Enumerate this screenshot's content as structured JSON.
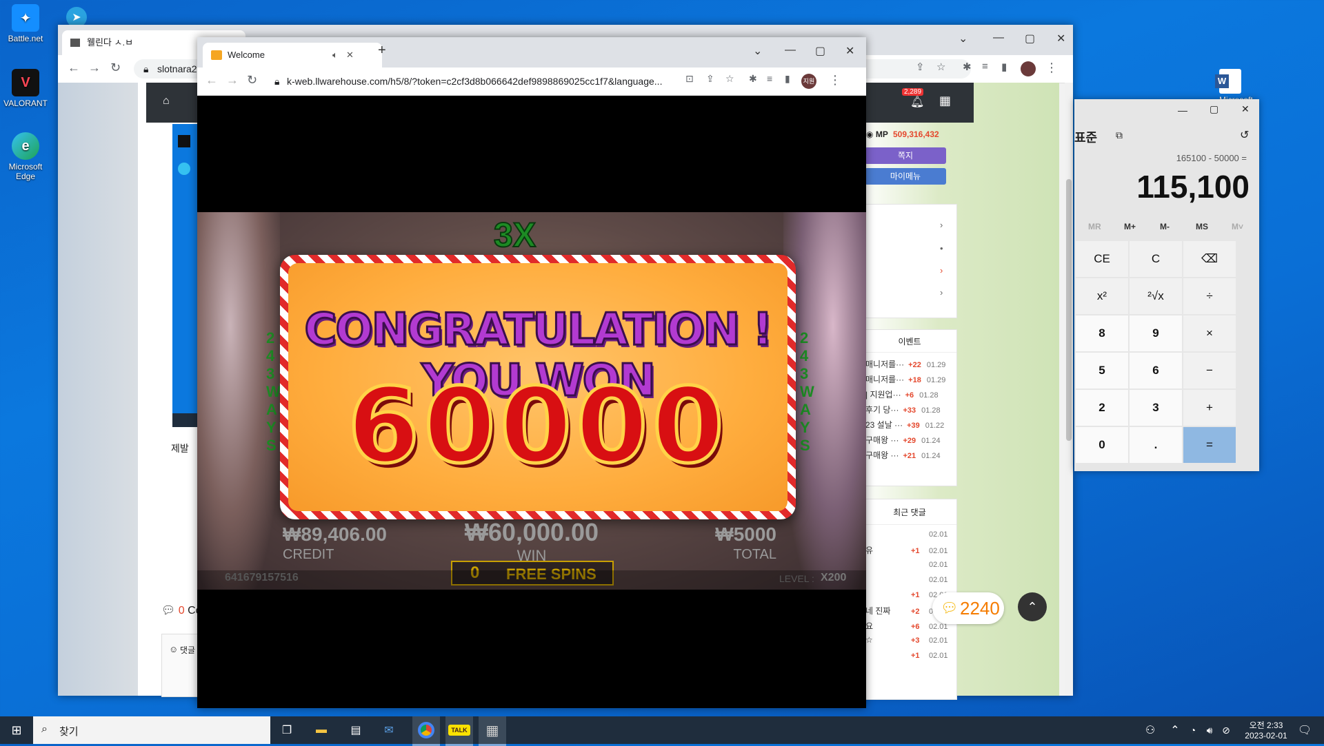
{
  "desktop": {
    "icons": [
      {
        "label": "Battle.net"
      },
      {
        "label": "VALORANT"
      },
      {
        "label": "Microsoft Edge"
      }
    ],
    "word_label": "Microsoft"
  },
  "back_browser": {
    "tab_title": "웰린다 ㅅ.ㅂ",
    "url": "slotnara2.",
    "notif_count": "2,289",
    "mp_label": "MP",
    "mp_value": "509,316,432",
    "btn_message": "쪽지",
    "btn_mymenu": "마이메뉴",
    "event_header": "이벤트",
    "events": [
      {
        "title": "매니저를···",
        "plus": "+22",
        "date": "01.29"
      },
      {
        "title": "매니저를···",
        "plus": "+18",
        "date": "01.29"
      },
      {
        "title": "| 지원업···",
        "plus": "+6",
        "date": "01.28"
      },
      {
        "title": "후기 당···",
        "plus": "+33",
        "date": "01.28"
      },
      {
        "title": "23 설날 ···",
        "plus": "+39",
        "date": "01.22"
      },
      {
        "title": "구매왕 ···",
        "plus": "+29",
        "date": "01.24"
      },
      {
        "title": "구매왕 ···",
        "plus": "+21",
        "date": "01.24"
      }
    ],
    "recent_header": "최근 댓글",
    "recent": [
      {
        "title": "",
        "plus": "",
        "date": "02.01"
      },
      {
        "title": "유",
        "plus": "+1",
        "date": "02.01"
      },
      {
        "title": "",
        "plus": "",
        "date": "02.01"
      },
      {
        "title": "",
        "plus": "",
        "date": "02.01"
      },
      {
        "title": "",
        "plus": "+1",
        "date": "02.01"
      },
      {
        "title": "네 진짜",
        "plus": "+2",
        "date": "02.01"
      },
      {
        "title": "요",
        "plus": "+6",
        "date": "02.01"
      },
      {
        "title": "☆",
        "plus": "+3",
        "date": "02.01"
      },
      {
        "title": "",
        "plus": "+1",
        "date": "02.01"
      }
    ],
    "left_text": "제발",
    "comment_count": "0",
    "comment_label": "Co",
    "comment_box": "댓글",
    "chat_count": "2240"
  },
  "front_browser": {
    "tab_title": "Welcome",
    "url": "k-web.llwarehouse.com/h5/8/?token=c2cf3d8b066642def9898869025cc1f7&language...",
    "profile": "지원"
  },
  "game": {
    "multiplier": "3X",
    "side_text": "243 WAYS",
    "congrats": "CONGRATULATION ! YOU WON",
    "big_win": "60000",
    "credit_value": "₩89,406.00",
    "credit_label": "CREDIT",
    "win_value": "₩60,000.00",
    "win_label": "WIN",
    "total_value": "₩5000",
    "total_label": "TOTAL",
    "free_spins_count": "0",
    "free_spins_label": "FREE SPINS",
    "round_id": "641679157516",
    "level_label": "LEVEL :",
    "level_value": "X200"
  },
  "calculator": {
    "mode": "표준",
    "expression": "165100 - 50000 =",
    "result": "115,100",
    "memory": [
      "MR",
      "M+",
      "M-",
      "MS",
      "M˅"
    ],
    "keys": [
      [
        "CE",
        "C",
        "⌫"
      ],
      [
        "x²",
        "²√x",
        "÷"
      ],
      [
        "8",
        "9",
        "×"
      ],
      [
        "5",
        "6",
        "−"
      ],
      [
        "2",
        "3",
        "+"
      ],
      [
        "0",
        ".",
        "="
      ]
    ]
  },
  "taskbar": {
    "search_placeholder": "찾기",
    "time": "오전 2:33",
    "date": "2023-02-01"
  },
  "colors": {
    "accent_purple": "#7b61c9",
    "accent_blue": "#4a7cd1",
    "plus_red": "#e4472c",
    "calc_equals": "#8fb8e2"
  }
}
